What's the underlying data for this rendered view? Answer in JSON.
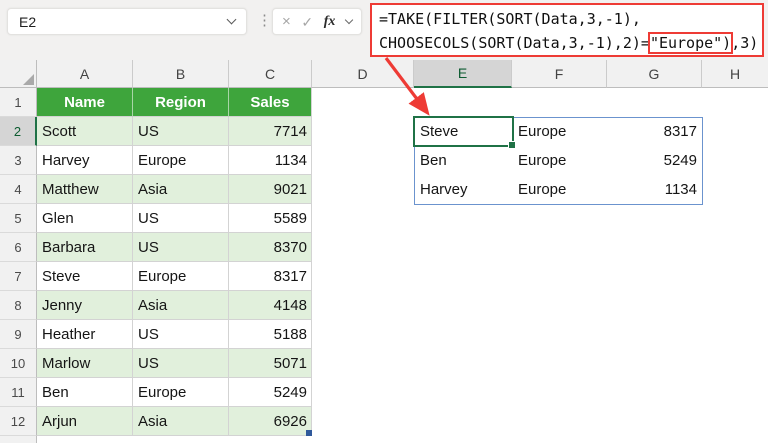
{
  "name_box": {
    "value": "E2"
  },
  "formula_bar": {
    "cancel_icon": "×",
    "enter_icon": "✓",
    "fx_label": "fx",
    "menu_icon": "⋮",
    "formula_line1": "=TAKE(FILTER(SORT(Data,3,-1),",
    "formula_line2_before": "CHOOSECOLS(SORT(Data,3,-1),2)=",
    "formula_line2_highlighted": "\"Europe\")",
    "formula_line2_after": ",3)"
  },
  "grid": {
    "column_headers": [
      "A",
      "B",
      "C",
      "D",
      "E",
      "F",
      "G",
      "H"
    ],
    "selected_column": "E",
    "row_headers": [
      "1",
      "2",
      "3",
      "4",
      "5",
      "6",
      "7",
      "8",
      "9",
      "10",
      "11",
      "12"
    ],
    "selected_row": "2",
    "selected_cell": "E2"
  },
  "table": {
    "headers": [
      "Name",
      "Region",
      "Sales"
    ],
    "rows": [
      [
        "Scott",
        "US",
        "7714"
      ],
      [
        "Harvey",
        "Europe",
        "1134"
      ],
      [
        "Matthew",
        "Asia",
        "9021"
      ],
      [
        "Glen",
        "US",
        "5589"
      ],
      [
        "Barbara",
        "US",
        "8370"
      ],
      [
        "Steve",
        "Europe",
        "8317"
      ],
      [
        "Jenny",
        "Asia",
        "4148"
      ],
      [
        "Heather",
        "US",
        "5188"
      ],
      [
        "Marlow",
        "US",
        "5071"
      ],
      [
        "Ben",
        "Europe",
        "5249"
      ],
      [
        "Arjun",
        "Asia",
        "6926"
      ]
    ]
  },
  "spill_result": {
    "rows": [
      [
        "Steve",
        "Europe",
        "8317"
      ],
      [
        "Ben",
        "Europe",
        "5249"
      ],
      [
        "Harvey",
        "Europe",
        "1134"
      ]
    ]
  },
  "colors": {
    "table-header-green": "#3EA53C",
    "band-green": "#E1F0DC",
    "selection-green": "#1F7246",
    "spill-blue": "#6B93CE",
    "annotation-red": "#EE3B35",
    "header-bg": "#F1F1F1",
    "header-selected-bg": "#D5D5D5"
  }
}
